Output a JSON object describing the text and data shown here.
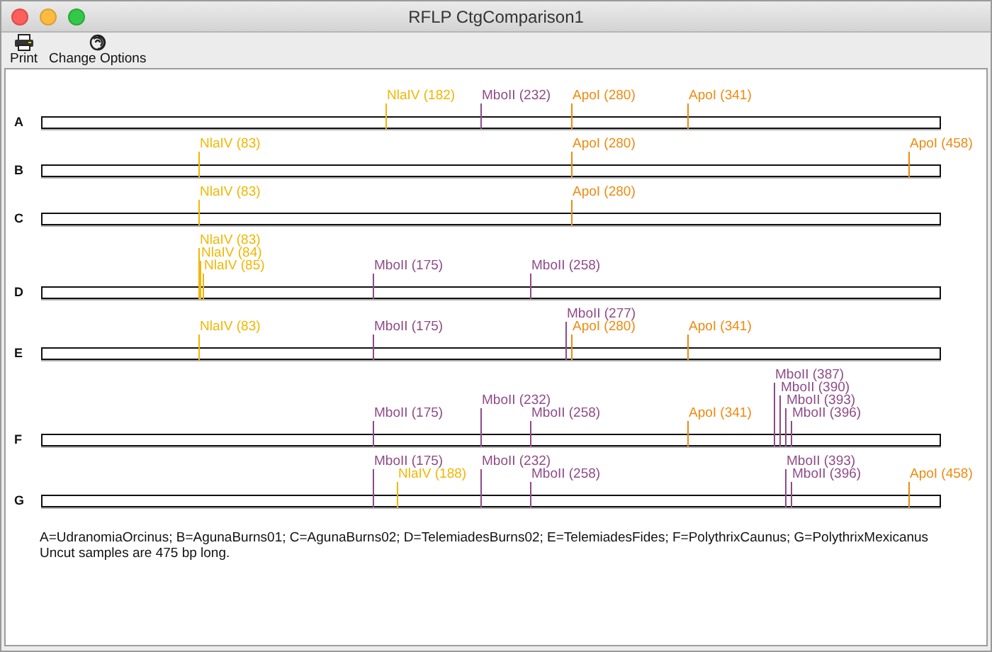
{
  "window": {
    "title": "RFLP CtgComparison1"
  },
  "toolbar": [
    {
      "kind": "print",
      "label": "Print"
    },
    {
      "kind": "options",
      "label": "Change Options"
    }
  ],
  "lanes": [
    {
      "name": "A",
      "sites": [
        {
          "label": "NlaIV (182)",
          "level": 0.3832,
          "color": "#f2b600"
        },
        {
          "label": "MboII (232)",
          "level": 0.4884,
          "color": "#8f4a88"
        },
        {
          "label": "ApoI (280)",
          "level": 0.5895,
          "color": "#ee8a10"
        },
        {
          "label": "ApoI (341)",
          "level": 0.7179,
          "color": "#ee8a10"
        }
      ]
    },
    {
      "name": "B",
      "sites": [
        {
          "label": "NlaIV (83)",
          "level": 0.1747,
          "color": "#f2b600"
        },
        {
          "label": "ApoI (280)",
          "level": 0.5895,
          "color": "#ee8a10"
        },
        {
          "label": "ApoI (458)",
          "level": 0.9642,
          "color": "#ee8a10"
        }
      ]
    },
    {
      "name": "C",
      "sites": [
        {
          "label": "NlaIV (83)",
          "level": 0.1747,
          "color": "#f2b600"
        },
        {
          "label": "ApoI (280)",
          "level": 0.5895,
          "color": "#ee8a10"
        }
      ]
    },
    {
      "name": "D",
      "sites": [
        {
          "label": "NlaIV (83)",
          "level": 0.1747,
          "color": "#f2b600"
        },
        {
          "label": "NlaIV (84)",
          "level": 0.1768,
          "color": "#f2b600"
        },
        {
          "label": "NlaIV (85)",
          "level": 0.1789,
          "color": "#f2b600"
        },
        {
          "label": "MboII (175)",
          "level": 0.3684,
          "color": "#8f4a88"
        },
        {
          "label": "MboII (258)",
          "level": 0.5432,
          "color": "#8f4a88"
        }
      ]
    },
    {
      "name": "E",
      "sites": [
        {
          "label": "NlaIV (83)",
          "level": 0.1747,
          "color": "#f2b600"
        },
        {
          "label": "MboII (175)",
          "level": 0.3684,
          "color": "#8f4a88"
        },
        {
          "label": "MboII (277)",
          "level": 0.5832,
          "color": "#8f4a88"
        },
        {
          "label": "ApoI (280)",
          "level": 0.5895,
          "color": "#ee8a10"
        },
        {
          "label": "ApoI (341)",
          "level": 0.7179,
          "color": "#ee8a10"
        }
      ]
    },
    {
      "name": "F",
      "sites": [
        {
          "label": "MboII (175)",
          "level": 0.3684,
          "color": "#8f4a88"
        },
        {
          "label": "MboII (232)",
          "level": 0.4884,
          "color": "#8f4a88"
        },
        {
          "label": "MboII (258)",
          "level": 0.5432,
          "color": "#8f4a88"
        },
        {
          "label": "ApoI (341)",
          "level": 0.7179,
          "color": "#ee8a10"
        },
        {
          "label": "MboII (387)",
          "level": 0.8147,
          "color": "#8f4a88"
        },
        {
          "label": "MboII (390)",
          "level": 0.8211,
          "color": "#8f4a88"
        },
        {
          "label": "MboII (393)",
          "level": 0.8274,
          "color": "#8f4a88"
        },
        {
          "label": "MboII (396)",
          "level": 0.8337,
          "color": "#8f4a88"
        }
      ]
    },
    {
      "name": "G",
      "sites": [
        {
          "label": "MboII (175)",
          "level": 0.3684,
          "color": "#8f4a88"
        },
        {
          "label": "NlaIV (188)",
          "level": 0.3958,
          "color": "#f2b600"
        },
        {
          "label": "MboII (232)",
          "level": 0.4884,
          "color": "#8f4a88"
        },
        {
          "label": "MboII (258)",
          "level": 0.5432,
          "color": "#8f4a88"
        },
        {
          "label": "MboII (393)",
          "level": 0.8274,
          "color": "#8f4a88"
        },
        {
          "label": "MboII (396)",
          "level": 0.8337,
          "color": "#8f4a88"
        },
        {
          "label": "ApoI (458)",
          "level": 0.9642,
          "color": "#ee8a10"
        }
      ]
    }
  ],
  "legend": "A=UdranomiaOrcinus; B=AgunaBurns01; C=AgunaBurns02; D=TelemiadesBurns02; E=TelemiadesFides; F=PolythrixCaunus; G=PolythrixMexicanus",
  "note": "Uncut samples are 475 bp long."
}
